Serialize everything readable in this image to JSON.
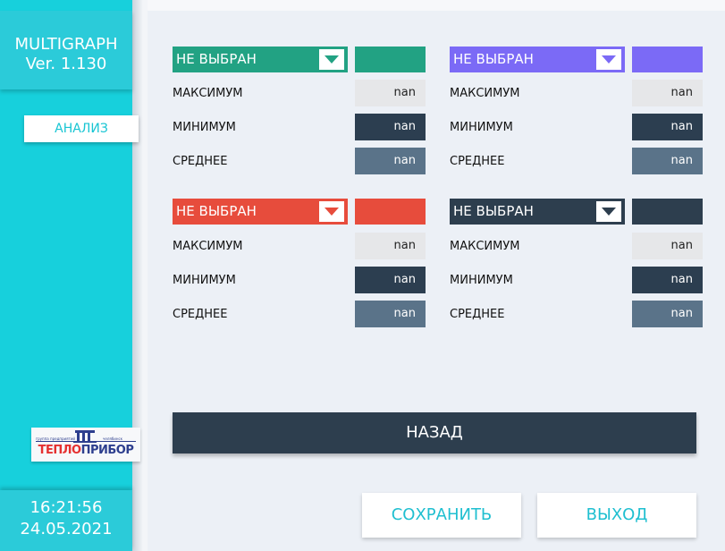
{
  "app": {
    "name": "MULTIGRAPH",
    "version": "Ver. 1.130"
  },
  "nav": {
    "analysis_label": "АНАЛИЗ"
  },
  "logo": {
    "text": "ТЕПЛОПРИБОР",
    "caption_left": "группа предприятий",
    "caption_right": "челябинск"
  },
  "clock": {
    "time": "16:21:56",
    "date": "24.05.2021"
  },
  "groups": [
    {
      "select": "НЕ ВЫБРАН",
      "color": "#22a283",
      "max_label": "МАКСИМУМ",
      "max": "nan",
      "min_label": "МИНИМУМ",
      "min": "nan",
      "avg_label": "СРЕДНЕЕ",
      "avg": "nan"
    },
    {
      "select": "НЕ ВЫБРАН",
      "color": "#7b6af6",
      "max_label": "МАКСИМУМ",
      "max": "nan",
      "min_label": "МИНИМУМ",
      "min": "nan",
      "avg_label": "СРЕДНЕЕ",
      "avg": "nan"
    },
    {
      "select": "НЕ ВЫБРАН",
      "color": "#e74c3c",
      "max_label": "МАКСИМУМ",
      "max": "nan",
      "min_label": "МИНИМУМ",
      "min": "nan",
      "avg_label": "СРЕДНЕЕ",
      "avg": "nan"
    },
    {
      "select": "НЕ ВЫБРАН",
      "color": "#2d3e4e",
      "max_label": "МАКСИМУМ",
      "max": "nan",
      "min_label": "МИНИМУМ",
      "min": "nan",
      "avg_label": "СРЕДНЕЕ",
      "avg": "nan"
    }
  ],
  "buttons": {
    "back": "НАЗАД",
    "save": "СОХРАНИТЬ",
    "exit": "ВЫХОД"
  },
  "icons": {
    "dropdown": "chevron-down-icon",
    "logo": "building-icon"
  }
}
